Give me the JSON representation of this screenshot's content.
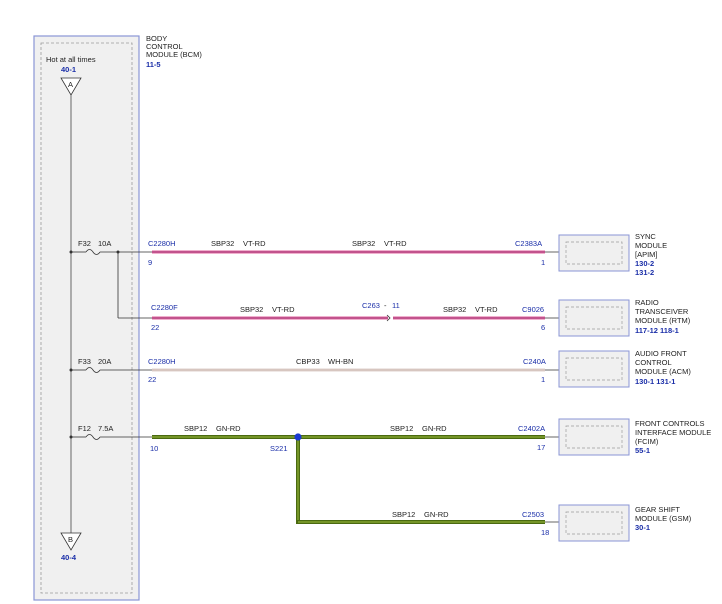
{
  "colors": {
    "module_border": "#8a95d6",
    "module_fill": "#f0f0f0",
    "link": "#1a2ea8",
    "wire_vtrd": "#e0609e",
    "wire_whbn": "#bfa59a",
    "wire_gnrd": "#4a6a10",
    "splice": "#1a3ad0"
  },
  "bcm": {
    "name_lines": [
      "BODY",
      "CONTROL",
      "MODULE (BCM)"
    ],
    "page_ref": "11-5",
    "hot_label": "Hot at all times",
    "hot_ref_top": "40-1",
    "connector_top": "A",
    "connector_bottom": "B",
    "hot_ref_bottom": "40-4"
  },
  "fuses": [
    {
      "id": "F32",
      "rating": "10A"
    },
    {
      "id": "F33",
      "rating": "20A"
    },
    {
      "id": "F12",
      "rating": "7.5A"
    }
  ],
  "circuits": [
    {
      "from_connector": "C2280H",
      "from_pin": "9",
      "wire_left": {
        "circuit": "SBP32",
        "color": "VT-RD"
      },
      "wire_right": {
        "circuit": "SBP32",
        "color": "VT-RD"
      },
      "to_connector": "C2383A",
      "to_pin": "1"
    },
    {
      "from_connector": "C2280F",
      "from_pin": "22",
      "wire_left": {
        "circuit": "SBP32",
        "color": "VT-RD"
      },
      "inline_connector": "C263",
      "inline_sep": "-",
      "inline_pin": "11",
      "wire_right": {
        "circuit": "SBP32",
        "color": "VT-RD"
      },
      "to_connector": "C9026",
      "to_pin": "6"
    },
    {
      "from_connector": "C2280H",
      "from_pin": "22",
      "wire": {
        "circuit": "CBP33",
        "color": "WH-BN"
      },
      "to_connector": "C240A",
      "to_pin": "1"
    },
    {
      "from_connector": "",
      "from_pin": "10",
      "wire_left": {
        "circuit": "SBP12",
        "color": "GN-RD"
      },
      "splice": "S221",
      "wire_right": {
        "circuit": "SBP12",
        "color": "GN-RD"
      },
      "to_connector": "C2402A",
      "to_pin": "17"
    },
    {
      "wire": {
        "circuit": "SBP12",
        "color": "GN-RD"
      },
      "to_connector": "C2503",
      "to_pin": "18"
    }
  ],
  "modules": [
    {
      "name_lines": [
        "SYNC",
        "MODULE",
        "[APIM]"
      ],
      "refs": [
        "130-2",
        "131-2"
      ]
    },
    {
      "name_lines": [
        "RADIO",
        "TRANSCEIVER",
        "MODULE (RTM)"
      ],
      "refs": [
        "117-12  118-1"
      ]
    },
    {
      "name_lines": [
        "AUDIO FRONT",
        "CONTROL",
        "MODULE (ACM)"
      ],
      "refs": [
        "130-1  131-1"
      ]
    },
    {
      "name_lines": [
        "FRONT CONTROLS",
        "INTERFACE MODULE",
        "(FCIM)"
      ],
      "refs": [
        "55-1"
      ]
    },
    {
      "name_lines": [
        "GEAR SHIFT",
        "MODULE (GSM)"
      ],
      "refs": [
        "30-1"
      ]
    }
  ]
}
